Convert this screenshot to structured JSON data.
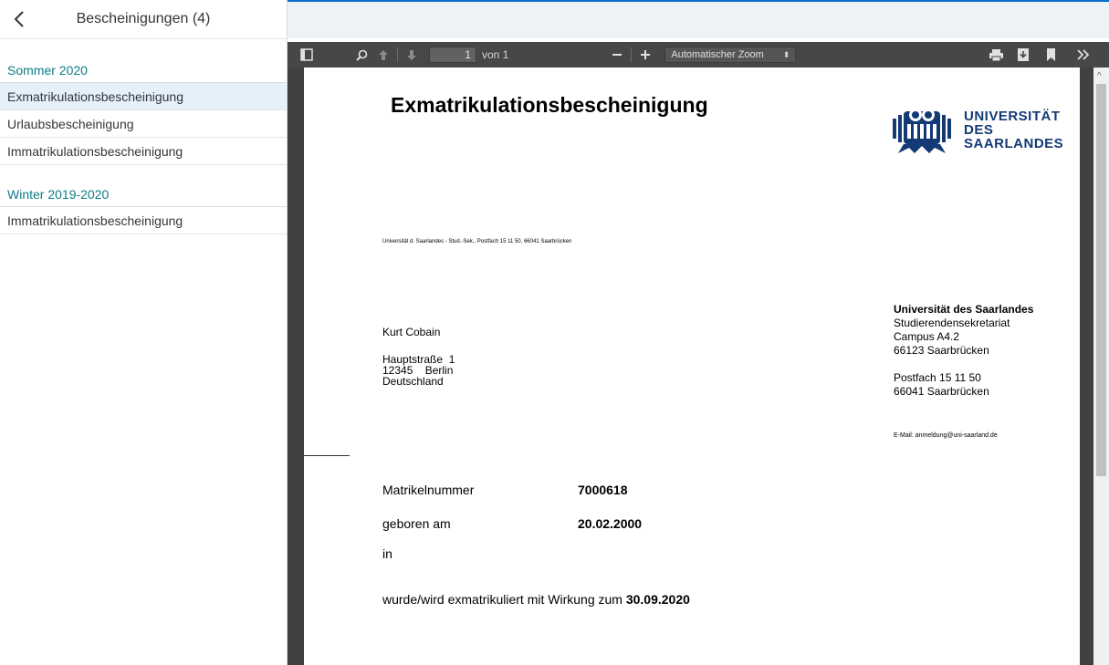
{
  "sidebar": {
    "title": "Bescheinigungen (4)",
    "groups": [
      {
        "title": "Sommer 2020",
        "items": [
          "Exmatrikulationsbescheinigung",
          "Urlaubsbescheinigung",
          "Immatrikulationsbescheinigung"
        ]
      },
      {
        "title": "Winter 2019-2020",
        "items": [
          "Immatrikulationsbescheinigung"
        ]
      }
    ]
  },
  "toolbar": {
    "page_number": "1",
    "page_of": "von 1",
    "zoom": "Automatischer Zoom",
    "icons": [
      "sidebar-toggle-icon",
      "search-icon",
      "arrow-up-icon",
      "arrow-down-icon",
      "zoom-out-icon",
      "zoom-in-icon",
      "print-icon",
      "download-icon",
      "bookmark-icon",
      "more-tools-icon"
    ]
  },
  "document": {
    "title": "Exmatrikulationsbescheinigung",
    "logo": {
      "line1": "UNIVERSITÄT",
      "line2": "DES",
      "line3": "SAARLANDES"
    },
    "sender_line": "Universität d. Saarlandes - Stud.-Sek., Postfach 15 11 50, 66041 Saarbrücken",
    "recipient": {
      "name": "Kurt Cobain",
      "street": "Hauptstraße  1",
      "city": "12345    Berlin",
      "country": "Deutschland"
    },
    "institution": {
      "name": "Universität des Saarlandes",
      "dept": "Studierendensekretariat",
      "campus": "Campus A4.2",
      "city": "66123 Saarbrücken",
      "postbox": "Postfach 15 11 50",
      "postbox_city": "66041 Saarbrücken",
      "email": "E-Mail: anmeldung@uni-saarland.de"
    },
    "fields": {
      "matrikel_label": "Matrikelnummer",
      "matrikel_value": "7000618",
      "born_label": "geboren am",
      "born_value": "20.02.2000",
      "in_label": "in",
      "exmat_text": "wurde/wird exmatrikuliert mit Wirkung zum",
      "exmat_date": "30.09.2020"
    }
  },
  "colors": {
    "accent": "#0a6ed1",
    "group_title": "#0e7c86",
    "selected_bg": "#e5f0fa",
    "toolbar": "#474747",
    "logo": "#133a75"
  }
}
